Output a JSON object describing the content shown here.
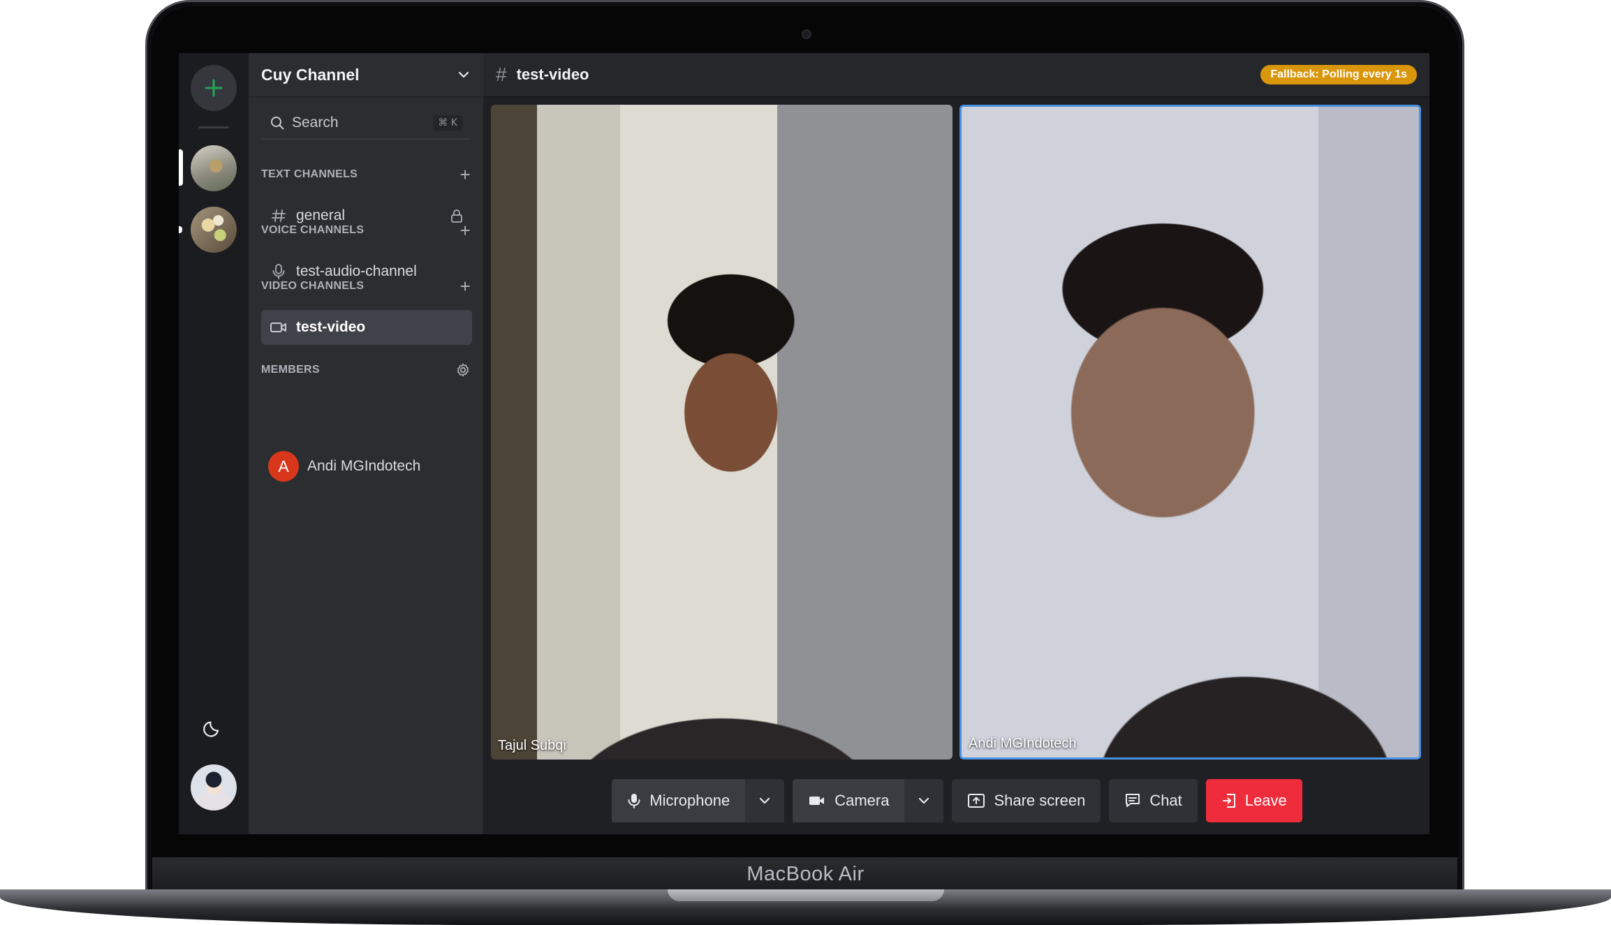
{
  "device": {
    "brand_label": "MacBook Air"
  },
  "server": {
    "name": "Cuy Channel",
    "icons": [
      "add-server-icon",
      "server-avatar-1",
      "server-avatar-2"
    ]
  },
  "search": {
    "label": "Search",
    "shortcut": "⌘ K"
  },
  "sections": {
    "text": "TEXT CHANNELS",
    "voice": "VOICE CHANNELS",
    "video": "VIDEO CHANNELS",
    "members": "MEMBERS"
  },
  "channels": {
    "text": [
      {
        "name": "general",
        "icon": "hash-icon",
        "locked": true
      }
    ],
    "voice": [
      {
        "name": "test-audio-channel",
        "icon": "microphone-icon"
      }
    ],
    "video": [
      {
        "name": "test-video",
        "icon": "video-camera-icon",
        "active": true
      }
    ]
  },
  "members": [
    {
      "initial": "A",
      "name": "Andi MGIndotech",
      "color": "#d9371b"
    }
  ],
  "topbar": {
    "channel": "test-video",
    "status_badge": "Fallback: Polling every 1s",
    "badge_color": "#d9960a"
  },
  "participants": [
    {
      "name": "Tajul Subqi",
      "highlighted": false
    },
    {
      "name": "Andi MGIndotech",
      "highlighted": true
    }
  ],
  "controls": {
    "microphone": "Microphone",
    "camera": "Camera",
    "share_screen": "Share screen",
    "chat": "Chat",
    "leave": "Leave",
    "leave_color": "#ef2c3b",
    "accent_color": "#23a55a"
  }
}
